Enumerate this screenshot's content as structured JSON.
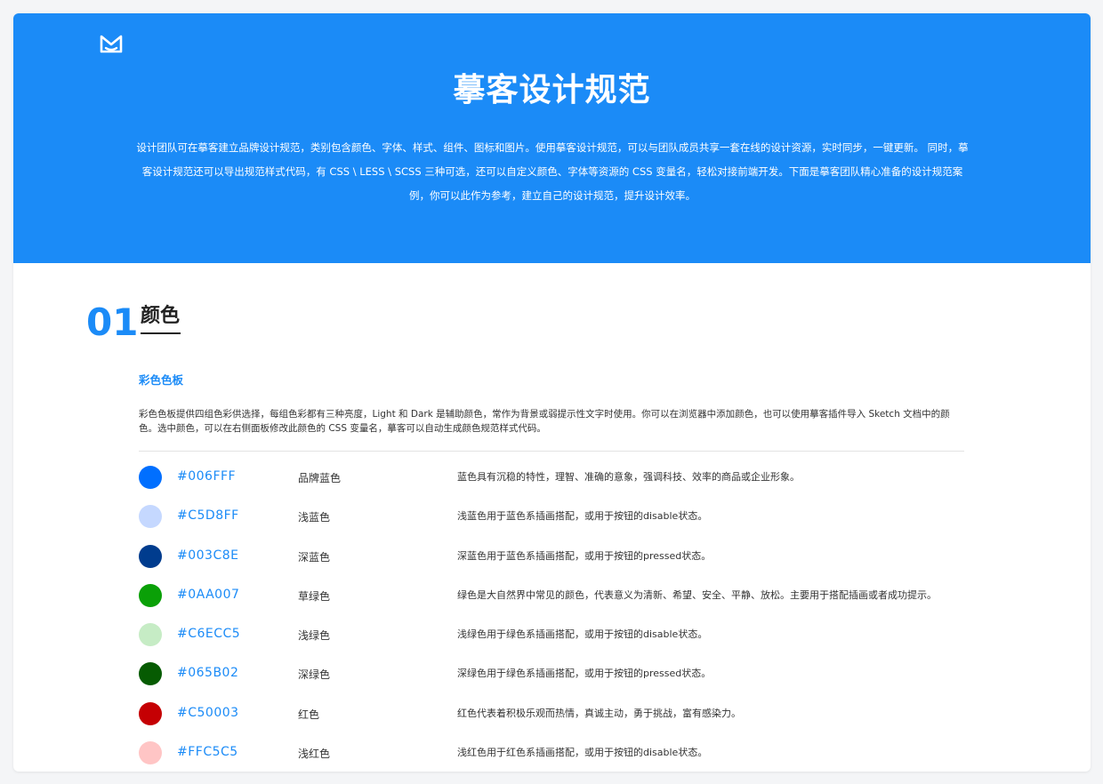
{
  "hero": {
    "title": "摹客设计规范",
    "description": "设计团队可在摹客建立品牌设计规范，类别包含颜色、字体、样式、组件、图标和图片。使用摹客设计规范，可以与团队成员共享一套在线的设计资源，实时同步，一键更新。 同时，摹客设计规范还可以导出规范样式代码，有 CSS \\ LESS \\ SCSS 三种可选，还可以自定义颜色、字体等资源的 CSS 变量名，轻松对接前端开发。下面是摹客团队精心准备的设计规范案例，你可以此作为参考，建立自己的设计规范，提升设计效率。"
  },
  "section": {
    "number": "01",
    "title": "颜色"
  },
  "palette": {
    "title": "彩色色板",
    "description": "彩色色板提供四组色彩供选择，每组色彩都有三种亮度，Light 和 Dark 是辅助颜色，常作为背景或弱提示性文字时使用。你可以在浏览器中添加颜色，也可以使用摹客插件导入 Sketch 文档中的颜色。选中颜色，可以在右侧面板修改此颜色的 CSS 变量名，摹客可以自动生成颜色规范样式代码。",
    "colors": [
      {
        "hex": "#006FFF",
        "name": "品牌蓝色",
        "desc": "蓝色具有沉稳的特性，理智、准确的意象，强调科技、效率的商品或企业形象。",
        "color": "#006FFF"
      },
      {
        "hex": "#C5D8FF",
        "name": "浅蓝色",
        "desc": "浅蓝色用于蓝色系插画搭配，或用于按钮的disable状态。",
        "color": "#C5D8FF"
      },
      {
        "hex": "#003C8E",
        "name": "深蓝色",
        "desc": "深蓝色用于蓝色系插画搭配，或用于按钮的pressed状态。",
        "color": "#003C8E"
      },
      {
        "hex": "#0AA007",
        "name": "草绿色",
        "desc": "绿色是大自然界中常见的颜色，代表意义为清新、希望、安全、平静、放松。主要用于搭配插画或者成功提示。",
        "color": "#0AA007"
      },
      {
        "hex": "#C6ECC5",
        "name": "浅绿色",
        "desc": "浅绿色用于绿色系插画搭配，或用于按钮的disable状态。",
        "color": "#C6ECC5"
      },
      {
        "hex": "#065B02",
        "name": "深绿色",
        "desc": "深绿色用于绿色系插画搭配，或用于按钮的pressed状态。",
        "color": "#065B02"
      },
      {
        "hex": "#C50003",
        "name": "红色",
        "desc": "红色代表着积极乐观而热情，真诚主动，勇于挑战，富有感染力。",
        "color": "#C50003"
      },
      {
        "hex": "#FFC5C5",
        "name": "浅红色",
        "desc": "浅红色用于红色系插画搭配，或用于按钮的disable状态。",
        "color": "#FFC5C5"
      }
    ]
  },
  "theme": {
    "brand_blue": "#1B8BF7",
    "logo_icon": "mockplus-logo-icon"
  }
}
